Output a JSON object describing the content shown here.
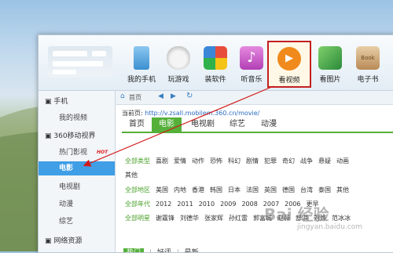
{
  "toolbar": {
    "items": [
      {
        "label": "我的手机",
        "icon": "phone-icon"
      },
      {
        "label": "玩游戏",
        "icon": "gamepad-icon"
      },
      {
        "label": "装软件",
        "icon": "apps-icon"
      },
      {
        "label": "听音乐",
        "icon": "music-icon"
      },
      {
        "label": "看视频",
        "icon": "video-play-icon"
      },
      {
        "label": "看图片",
        "icon": "picture-icon"
      },
      {
        "label": "电子书",
        "icon": "book-icon"
      }
    ]
  },
  "navbar": {
    "home": "首页"
  },
  "breadcrumb": {
    "prefix": "当前页:",
    "url": "http://v.zsall.mobilem.360.cn/movie/"
  },
  "sidebar": {
    "section1": "手机",
    "my_video": "我的视频",
    "section2": "360移动视界",
    "hot_label": "热门影视",
    "hot_badge": "HOT",
    "items": [
      "电影",
      "电视剧",
      "动漫",
      "综艺"
    ],
    "section3": "网络资源"
  },
  "tabs": [
    "首页",
    "电影",
    "电视剧",
    "综艺",
    "动漫"
  ],
  "filters": {
    "type_all": "全部类型",
    "types_line1": [
      "喜剧",
      "爱情",
      "动作",
      "恐怖",
      "科幻",
      "剧情",
      "犯罪",
      "奇幻",
      "战争",
      "悬疑",
      "动画"
    ],
    "types_line2": [
      "其他"
    ],
    "region_all": "全部地区",
    "regions": [
      "美国",
      "内地",
      "香港",
      "韩国",
      "日本",
      "法国",
      "英国",
      "德国",
      "台湾",
      "泰国",
      "其他"
    ],
    "year_all": "全部年代",
    "years": [
      "2012",
      "2011",
      "2010",
      "2009",
      "2008",
      "2007",
      "2006",
      "更早"
    ],
    "star_all": "全部明星",
    "stars": [
      "谢霆锋",
      "刘德华",
      "张家辉",
      "孙红雷",
      "郭富城",
      "赵薇",
      "舒淇",
      "刘烨",
      "范冰冰"
    ]
  },
  "sort": {
    "hot": "热门",
    "good": "好评",
    "new": "最新",
    "sep": "|"
  },
  "watermark": {
    "main": "Bai 经验",
    "sub": "jingyan.baidu.com"
  },
  "colors": {
    "accent_green": "#55b03a",
    "highlight_red": "#c41f1f",
    "sidebar_selected": "#3f9ee6",
    "link": "#2a6cc2"
  }
}
